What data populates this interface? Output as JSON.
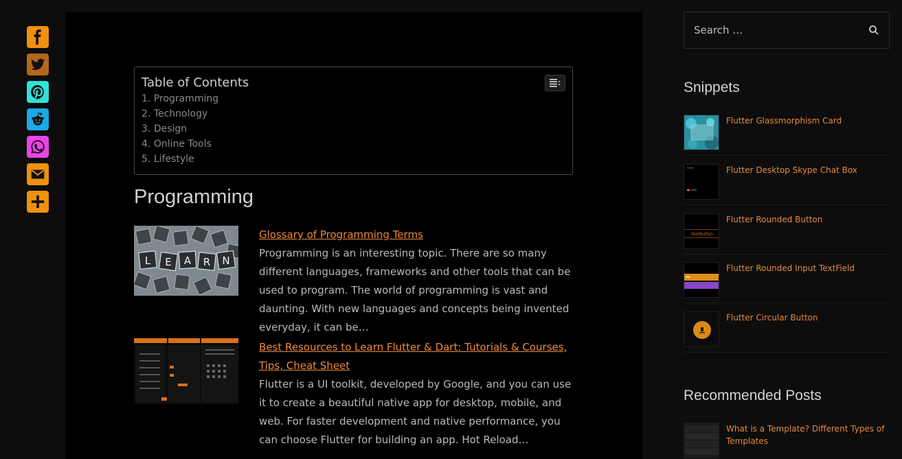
{
  "share": {
    "buttons": [
      {
        "name": "facebook",
        "icon": "facebook-icon",
        "color": "#f0900d"
      },
      {
        "name": "twitter",
        "icon": "twitter-icon",
        "color": "#b4671c"
      },
      {
        "name": "pinterest",
        "icon": "pinterest-icon",
        "color": "#31e1d9"
      },
      {
        "name": "reddit",
        "icon": "reddit-icon",
        "color": "#19a9e6"
      },
      {
        "name": "whatsapp",
        "icon": "whatsapp-icon",
        "color": "#ea43e6"
      },
      {
        "name": "email",
        "icon": "email-icon",
        "color": "#f0900d"
      },
      {
        "name": "more",
        "icon": "plus-icon",
        "color": "#f0900d"
      }
    ]
  },
  "toc": {
    "title": "Table of Contents",
    "items": [
      {
        "num": "1.",
        "label": "Programming"
      },
      {
        "num": "2.",
        "label": "Technology"
      },
      {
        "num": "3.",
        "label": "Design"
      },
      {
        "num": "4.",
        "label": "Online Tools"
      },
      {
        "num": "5.",
        "label": "Lifestyle"
      }
    ]
  },
  "section": {
    "title": "Programming"
  },
  "posts": [
    {
      "title": "Glossary of Programming Terms",
      "excerpt": "Programming is an interesting topic. There are so many different languages, frameworks and other tools that can be used to program. The world of programming is vast and daunting. With new languages and concepts being invented everyday, it can be…",
      "thumb_letters": [
        "L",
        "E",
        "A",
        "R",
        "N"
      ]
    },
    {
      "title": "Best Resources to Learn Flutter & Dart: Tutorials & Courses, Tips, Cheat Sheet",
      "excerpt": "Flutter is a UI toolkit, developed by Google, and you can use it to create a beautiful native app for desktop, mobile, and web. For faster development and native performance, you can choose Flutter for building an app. Hot Reload…"
    }
  ],
  "sidebar": {
    "search": {
      "placeholder": "Search …",
      "icon": "search-icon"
    },
    "snippets_title": "Snippets",
    "snippets": [
      {
        "label": "Flutter Glassmorphism Card"
      },
      {
        "label": "Flutter Desktop Skype Chat Box"
      },
      {
        "label": "Flutter Rounded Button",
        "thumb_text": "TextButton"
      },
      {
        "label": "Flutter Rounded Input TextField"
      },
      {
        "label": "Flutter Circular Button"
      }
    ],
    "recommended_title": "Recommended Posts",
    "recommended": [
      {
        "label": "What is a Template? Different Types of Templates"
      }
    ]
  },
  "colors": {
    "accent": "#ee8a3c",
    "background": "#0d0d0d",
    "article_bg": "#000000"
  }
}
